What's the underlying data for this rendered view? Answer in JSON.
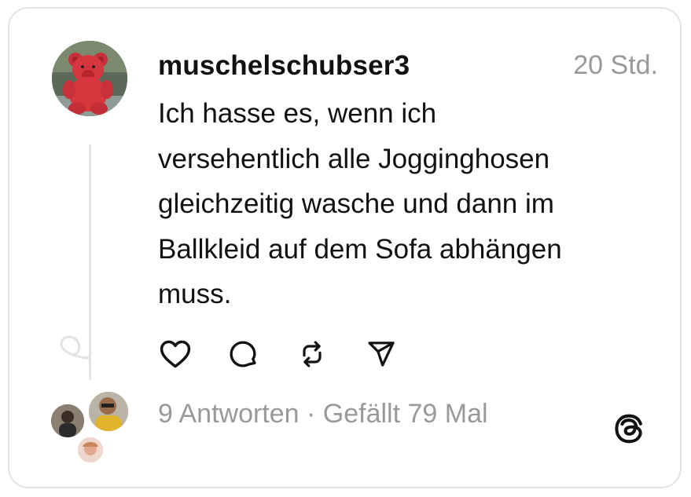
{
  "post": {
    "username": "muschelschubser3",
    "timestamp": "20 Std.",
    "text_lines": [
      "Ich hasse es, wenn ich",
      "versehentlich alle Jogginghosen",
      "gleichzeitig wasche und dann im",
      "Ballkleid auf dem Sofa abhängen",
      "muss."
    ]
  },
  "actions": {
    "like": "heart-icon",
    "reply": "speech-bubble-icon",
    "repost": "repost-icon",
    "share": "paper-plane-icon"
  },
  "footer": {
    "replies": "9 Antworten",
    "separator": "·",
    "likes": "Gefällt 79 Mal"
  },
  "brand": {
    "logo": "threads-logo-icon"
  },
  "colors": {
    "text": "#111111",
    "muted": "#999999",
    "border": "#e4e4e4",
    "avatar_bear": "#d7363f"
  }
}
